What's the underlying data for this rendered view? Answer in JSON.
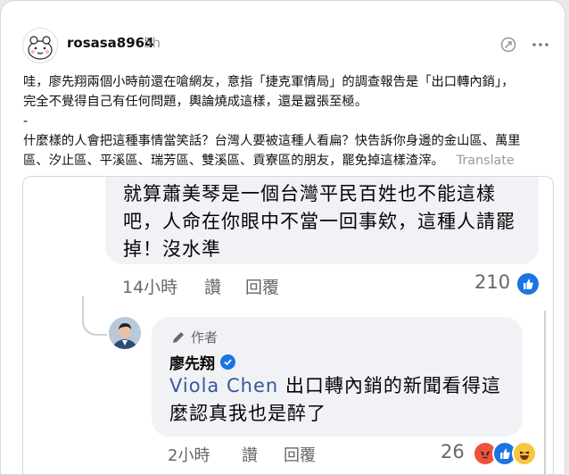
{
  "post": {
    "username": "rosasa8964",
    "time": "5h",
    "paragraph1": "哇，廖先翔兩個小時前還在嗆網友，意指「捷克軍情局」的調查報告是「出口轉內銷」，\n完全不覺得自己有任何問題，輿論燒成這樣，還是囂張至極。\n-\n什麼樣的人會把這種事情當笑話？台灣人要被這種人看扁？快告訴你身邊的金山區、萬里\n區、汐止區、平溪區、瑞芳區、雙溪區、貢寮區的朋友，罷免掉這樣渣滓。",
    "translate_label": "Translate"
  },
  "screenshot": {
    "comment1": {
      "text": "就算蕭美琴是一個台灣平民百姓也不能這樣吧，人命在你眼中不當一回事欸，這種人請罷掉！沒水準",
      "time": "14小時",
      "like_label": "讚",
      "reply_label": "回覆",
      "reaction_count": "210"
    },
    "reply": {
      "author_tag": "作者",
      "name": "廖先翔",
      "mention": "Viola Chen",
      "text": " 出口轉內銷的新聞看得這麼認真我也是醉了",
      "time": "2小時",
      "like_label": "讚",
      "reply_label": "回覆",
      "reaction_count": "26"
    }
  },
  "colors": {
    "facebook_blue": "#1b74e4",
    "bubble_bg": "#f0f2f5",
    "meta_gray": "#65676b"
  },
  "icons": [
    "avatar-icon",
    "repost-icon",
    "more-icon",
    "like-icon",
    "pencil-icon",
    "verified-icon",
    "angry-icon",
    "haha-icon"
  ]
}
